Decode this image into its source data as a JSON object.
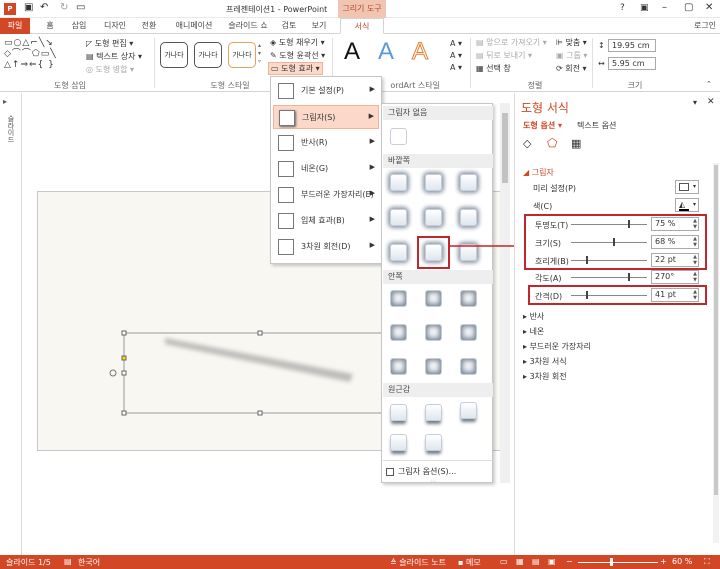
{
  "app": {
    "title": "프레젠테이션1 - PowerPoint",
    "ctx_tab": "그리기 도구",
    "help": "?",
    "login": "로그인"
  },
  "tabs": [
    "파일",
    "홈",
    "삽입",
    "디자인",
    "전환",
    "애니메이션",
    "슬라이드 쇼",
    "검토",
    "보기",
    "서식"
  ],
  "ribbon": {
    "insert_group": {
      "label": "도형 삽입",
      "edit_shape": "도형 편집",
      "text_box": "텍스트 상자",
      "merge": "도형 병합"
    },
    "styles_group": {
      "label": "도형 스타일",
      "preset": "가나다"
    },
    "fill": "도형 채우기",
    "outline": "도형 윤곽선",
    "effects": "도형 효과",
    "wordart_label": "ordArt 스타일",
    "wordart_letter": "A",
    "arrange": {
      "bring_forward": "앞으로 가져오기",
      "send_backward": "뒤로 보내기",
      "selection_pane": "선택 창",
      "align": "맞춤",
      "group": "그룹",
      "rotate": "회전",
      "label": "정렬"
    },
    "size": {
      "height": "19.95 cm",
      "width": "5.95 cm",
      "label": "크기"
    }
  },
  "effects_menu": [
    {
      "label": "기본 설정(P)"
    },
    {
      "label": "그림자(S)"
    },
    {
      "label": "반사(R)"
    },
    {
      "label": "네온(G)"
    },
    {
      "label": "부드러운 가장자리(E)"
    },
    {
      "label": "입체 효과(B)"
    },
    {
      "label": "3차원 회전(D)"
    }
  ],
  "shadow_submenu": {
    "none": "그림자 없음",
    "outer": "바깥쪽",
    "inner": "안쪽",
    "perspective": "원근감",
    "options": "그림자 옵션(S)..."
  },
  "format_panel": {
    "title": "도형 서식",
    "tab_shape": "도형 옵션",
    "tab_text": "텍스트 옵션",
    "shadow_header": "그림자",
    "preset_label": "미리 설정(P)",
    "color_label": "색(C)",
    "rows": [
      {
        "label": "투명도(T)",
        "value": "75 %",
        "level": 0.75
      },
      {
        "label": "크기(S)",
        "value": "68 %",
        "level": 0.55
      },
      {
        "label": "흐리게(B)",
        "value": "22 pt",
        "level": 0.2
      },
      {
        "label": "각도(A)",
        "value": "270°",
        "level": 0.75
      },
      {
        "label": "간격(D)",
        "value": "41 pt",
        "level": 0.2
      }
    ],
    "collapsed": [
      "반사",
      "네온",
      "부드러운 가장자리",
      "3차원 서식",
      "3차원 회전"
    ]
  },
  "left_strip": "슬라이드",
  "status": {
    "slide": "슬라이드 1/5",
    "lang": "한국어",
    "notes": "슬라이드 노트",
    "memo": "메모",
    "zoom": "60 %"
  },
  "colors": {
    "accent": "#d24726",
    "highlight": "#c0272d",
    "selected": "#fbd8c7"
  }
}
